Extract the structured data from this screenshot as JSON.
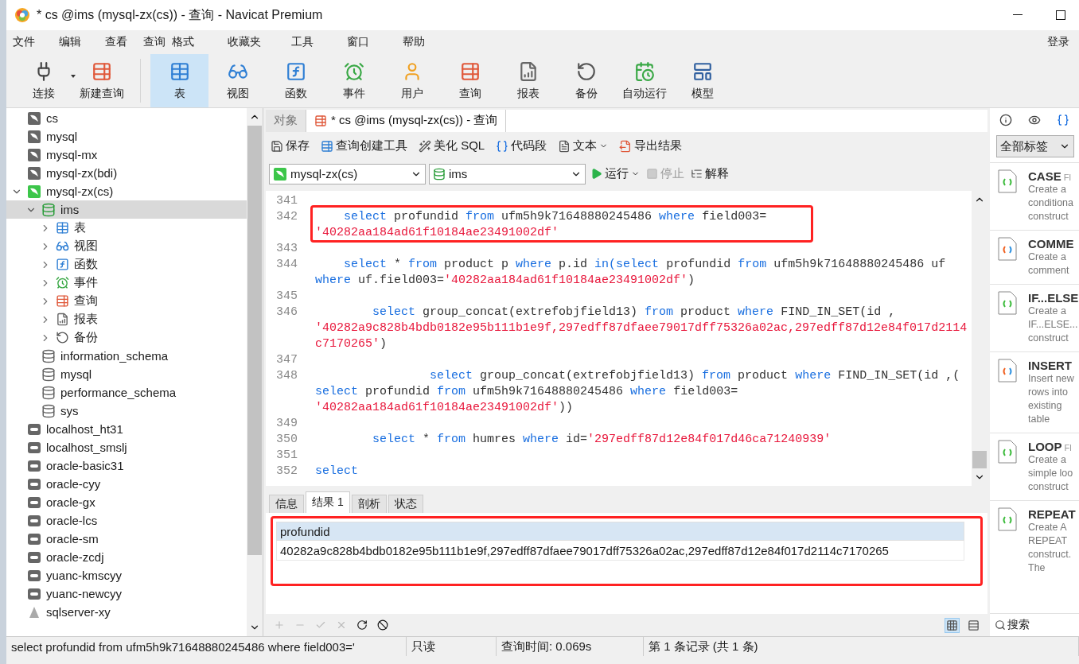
{
  "window": {
    "title": "* cs @ims (mysql-zx(cs)) - 查询 - Navicat Premium"
  },
  "menu": {
    "items": [
      "文件",
      "编辑",
      "查看",
      "查询",
      "格式",
      "收藏夹",
      "工具",
      "窗口",
      "帮助"
    ],
    "login": "登录"
  },
  "toolbar": [
    {
      "kind": "connect",
      "label": "连接",
      "selected": false,
      "dropdown": true
    },
    {
      "kind": "new_query",
      "label": "新建查询",
      "selected": false,
      "dropdown": false
    },
    {
      "kind": "table",
      "label": "表",
      "selected": true,
      "dropdown": false
    },
    {
      "kind": "view",
      "label": "视图",
      "selected": false,
      "dropdown": false
    },
    {
      "kind": "function",
      "label": "函数",
      "selected": false,
      "dropdown": false
    },
    {
      "kind": "event",
      "label": "事件",
      "selected": false,
      "dropdown": false
    },
    {
      "kind": "user",
      "label": "用户",
      "selected": false,
      "dropdown": false
    },
    {
      "kind": "query",
      "label": "查询",
      "selected": false,
      "dropdown": false
    },
    {
      "kind": "report",
      "label": "报表",
      "selected": false,
      "dropdown": false
    },
    {
      "kind": "backup",
      "label": "备份",
      "selected": false,
      "dropdown": false
    },
    {
      "kind": "schedule",
      "label": "自动运行",
      "selected": false,
      "dropdown": false
    },
    {
      "kind": "model",
      "label": "模型",
      "selected": false,
      "dropdown": false
    }
  ],
  "sidebar": {
    "items": [
      {
        "kind": "mysql",
        "label": "cs",
        "selected": false
      },
      {
        "kind": "mysql",
        "label": "mysql",
        "selected": false
      },
      {
        "kind": "mysql",
        "label": "mysql-mx",
        "selected": false
      },
      {
        "kind": "mysql",
        "label": "mysql-zx(bdi)",
        "selected": false
      },
      {
        "kind": "mysql_open",
        "label": "mysql-zx(cs)",
        "selected": false,
        "expanded": true,
        "children": [
          {
            "kind": "database_open",
            "label": "ims",
            "selected": true,
            "expanded": true,
            "children": [
              {
                "kind": "table",
                "label": "表",
                "selected": false,
                "expanded": false
              },
              {
                "kind": "view",
                "label": "视图",
                "selected": false,
                "expanded": false
              },
              {
                "kind": "function",
                "label": "函数",
                "selected": false,
                "expanded": false
              },
              {
                "kind": "event",
                "label": "事件",
                "selected": false,
                "expanded": false
              },
              {
                "kind": "query",
                "label": "查询",
                "selected": false,
                "expanded": false
              },
              {
                "kind": "report",
                "label": "报表",
                "selected": false,
                "expanded": false
              },
              {
                "kind": "backup",
                "label": "备份",
                "selected": false,
                "expanded": false
              }
            ]
          },
          {
            "kind": "database",
            "label": "information_schema",
            "selected": false
          },
          {
            "kind": "database",
            "label": "mysql",
            "selected": false
          },
          {
            "kind": "database",
            "label": "performance_schema",
            "selected": false
          },
          {
            "kind": "database",
            "label": "sys",
            "selected": false
          }
        ]
      },
      {
        "kind": "generic",
        "label": "localhost_ht31",
        "selected": false
      },
      {
        "kind": "generic",
        "label": "localhost_smslj",
        "selected": false
      },
      {
        "kind": "generic",
        "label": "oracle-basic31",
        "selected": false
      },
      {
        "kind": "generic",
        "label": "oracle-cyy",
        "selected": false
      },
      {
        "kind": "generic",
        "label": "oracle-gx",
        "selected": false
      },
      {
        "kind": "generic",
        "label": "oracle-lcs",
        "selected": false
      },
      {
        "kind": "generic",
        "label": "oracle-sm",
        "selected": false
      },
      {
        "kind": "generic",
        "label": "oracle-zcdj",
        "selected": false
      },
      {
        "kind": "generic",
        "label": "yuanc-kmscyy",
        "selected": false
      },
      {
        "kind": "generic",
        "label": "yuanc-newcyy",
        "selected": false
      },
      {
        "kind": "sqlserver",
        "label": "sqlserver-xy",
        "selected": false
      }
    ]
  },
  "editor_tabs": [
    {
      "label": "对象",
      "selected": false,
      "icon": false
    },
    {
      "label": "* cs @ims (mysql-zx(cs)) - 查询",
      "selected": true,
      "icon": true
    }
  ],
  "editor_toolbar": [
    {
      "kind": "save",
      "label": "保存",
      "dropdown": false
    },
    {
      "kind": "builder",
      "label": "查询创建工具",
      "dropdown": false
    },
    {
      "kind": "beautify",
      "label": "美化 SQL",
      "dropdown": false
    },
    {
      "kind": "snippet",
      "label": "代码段",
      "dropdown": false
    },
    {
      "kind": "text",
      "label": "文本",
      "dropdown": true
    },
    {
      "kind": "export",
      "label": "导出结果",
      "dropdown": false
    }
  ],
  "connection_select": "mysql-zx(cs)",
  "database_select": "ims",
  "run_controls": [
    {
      "kind": "run",
      "label": "运行",
      "disabled": false,
      "dropdown": true
    },
    {
      "kind": "stop",
      "label": "停止",
      "disabled": true,
      "dropdown": false
    },
    {
      "kind": "explain",
      "label": "解释",
      "disabled": false,
      "dropdown": false
    }
  ],
  "code": [
    {
      "number": "341",
      "highlighted": false
    },
    {
      "number": "342",
      "highlighted": true,
      "rows": [
        {
          "segments": [
            {
              "kind": "keyword",
              "text": "    select"
            },
            {
              "kind": "plain",
              "text": " profundid "
            },
            {
              "kind": "keyword",
              "text": "from"
            },
            {
              "kind": "plain",
              "text": " ufm5h9k71648880245486 "
            },
            {
              "kind": "keyword",
              "text": "where"
            },
            {
              "kind": "plain",
              "text": " field003="
            }
          ]
        },
        {
          "segments": [
            {
              "kind": "string",
              "text": "'40282aa184ad61f10184ae23491002df'"
            }
          ]
        }
      ]
    },
    {
      "number": "343",
      "highlighted": false
    },
    {
      "number": "344",
      "highlighted": false,
      "rows": [
        {
          "segments": [
            {
              "kind": "keyword",
              "text": "    select"
            },
            {
              "kind": "plain",
              "text": " * "
            },
            {
              "kind": "keyword",
              "text": "from"
            },
            {
              "kind": "plain",
              "text": " product p "
            },
            {
              "kind": "keyword",
              "text": "where"
            },
            {
              "kind": "plain",
              "text": " p.id "
            },
            {
              "kind": "keyword",
              "text": "in(select"
            },
            {
              "kind": "plain",
              "text": " profundid "
            },
            {
              "kind": "keyword",
              "text": "from"
            },
            {
              "kind": "plain",
              "text": " ufm5h9k71648880245486 uf"
            }
          ]
        },
        {
          "segments": [
            {
              "kind": "keyword",
              "text": "where"
            },
            {
              "kind": "plain",
              "text": " uf.field003="
            },
            {
              "kind": "string",
              "text": "'40282aa184ad61f10184ae23491002df'"
            },
            {
              "kind": "plain",
              "text": ")"
            }
          ]
        }
      ]
    },
    {
      "number": "345",
      "highlighted": false
    },
    {
      "number": "346",
      "highlighted": false,
      "rows": [
        {
          "segments": [
            {
              "kind": "keyword",
              "text": "        select"
            },
            {
              "kind": "plain",
              "text": " group_concat(extrefobjfield13) "
            },
            {
              "kind": "keyword",
              "text": "from"
            },
            {
              "kind": "plain",
              "text": " product "
            },
            {
              "kind": "keyword",
              "text": "where"
            },
            {
              "kind": "plain",
              "text": " FIND_IN_SET(id ,"
            }
          ]
        },
        {
          "segments": [
            {
              "kind": "string",
              "text": "'40282a9c828b4bdb0182e95b111b1e9f,297edff87dfaee79017dff75326a02ac,297edff87d12e84f017d2114"
            }
          ]
        },
        {
          "segments": [
            {
              "kind": "string",
              "text": "c7170265'"
            },
            {
              "kind": "plain",
              "text": ")"
            }
          ]
        }
      ]
    },
    {
      "number": "347",
      "highlighted": false
    },
    {
      "number": "348",
      "highlighted": false,
      "rows": [
        {
          "segments": [
            {
              "kind": "keyword",
              "text": "                select"
            },
            {
              "kind": "plain",
              "text": " group_concat(extrefobjfield13) "
            },
            {
              "kind": "keyword",
              "text": "from"
            },
            {
              "kind": "plain",
              "text": " product "
            },
            {
              "kind": "keyword",
              "text": "where"
            },
            {
              "kind": "plain",
              "text": " FIND_IN_SET(id ,("
            }
          ]
        },
        {
          "segments": [
            {
              "kind": "keyword",
              "text": "select"
            },
            {
              "kind": "plain",
              "text": " profundid "
            },
            {
              "kind": "keyword",
              "text": "from"
            },
            {
              "kind": "plain",
              "text": " ufm5h9k71648880245486 "
            },
            {
              "kind": "keyword",
              "text": "where"
            },
            {
              "kind": "plain",
              "text": " field003="
            }
          ]
        },
        {
          "segments": [
            {
              "kind": "string",
              "text": "'40282aa184ad61f10184ae23491002df'"
            },
            {
              "kind": "plain",
              "text": "))"
            }
          ]
        }
      ]
    },
    {
      "number": "349",
      "highlighted": false
    },
    {
      "number": "350",
      "highlighted": false,
      "rows": [
        {
          "segments": [
            {
              "kind": "keyword",
              "text": "        select"
            },
            {
              "kind": "plain",
              "text": " * "
            },
            {
              "kind": "keyword",
              "text": "from"
            },
            {
              "kind": "plain",
              "text": " humres "
            },
            {
              "kind": "keyword",
              "text": "where"
            },
            {
              "kind": "plain",
              "text": " id="
            },
            {
              "kind": "string",
              "text": "'297edff87d12e84f017d46ca71240939'"
            }
          ]
        }
      ]
    },
    {
      "number": "351",
      "highlighted": false
    },
    {
      "number": "352",
      "highlighted": false,
      "rows": [
        {
          "segments": [
            {
              "kind": "keyword",
              "text": "select"
            }
          ]
        }
      ]
    }
  ],
  "result_tabs": [
    {
      "label": "信息",
      "selected": false
    },
    {
      "label": "结果 1",
      "selected": true
    },
    {
      "label": "剖析",
      "selected": false
    },
    {
      "label": "状态",
      "selected": false
    }
  ],
  "result_grid": {
    "highlighted": true,
    "columns": [
      "profundid"
    ],
    "rows": [
      [
        "40282a9c828b4bdb0182e95b111b1e9f,297edff87dfaee79017dff75326a02ac,297edff87d12e84f017d2114c7170265"
      ]
    ]
  },
  "grid_actions": [
    {
      "kind": "add",
      "disabled": true
    },
    {
      "kind": "remove",
      "disabled": true
    },
    {
      "kind": "apply",
      "disabled": true
    },
    {
      "kind": "discard",
      "disabled": true
    },
    {
      "kind": "refresh",
      "disabled": false
    },
    {
      "kind": "stop",
      "disabled": false
    }
  ],
  "view_modes": [
    {
      "kind": "grid",
      "selected": true
    },
    {
      "kind": "form",
      "selected": false
    }
  ],
  "snippet_panel": {
    "tabs": [
      {
        "kind": "info",
        "selected": false
      },
      {
        "kind": "preview",
        "selected": false
      },
      {
        "kind": "snippets",
        "selected": true
      }
    ],
    "filter": "全部标签",
    "items": [
      {
        "title": "CASE",
        "tag": "Fl",
        "multicolor": false,
        "description": [
          "Create a",
          "conditiona",
          "construct"
        ]
      },
      {
        "title": "COMME",
        "multicolor": true,
        "description": [
          "Create a",
          "comment"
        ]
      },
      {
        "title": "IF...ELSE",
        "multicolor": false,
        "description": [
          "Create a",
          "IF...ELSE...",
          "construct"
        ]
      },
      {
        "title": "INSERT",
        "multicolor": true,
        "description": [
          "Insert new",
          "rows into",
          "existing",
          "table"
        ]
      },
      {
        "title": "LOOP",
        "tag": "Fl",
        "multicolor": false,
        "description": [
          "Create a",
          "simple loo",
          "construct"
        ]
      },
      {
        "title": "REPEAT",
        "multicolor": false,
        "description": [
          "Create A",
          "REPEAT",
          "construct.",
          "The"
        ]
      }
    ],
    "search": "搜索"
  },
  "status_bar": [
    {
      "kind": "sql",
      "text": "select profundid from ufm5h9k71648880245486 where field003='"
    },
    {
      "kind": "mode",
      "text": "只读"
    },
    {
      "kind": "time",
      "text": "查询时间: 0.069s"
    },
    {
      "kind": "records",
      "text": "第 1 条记录 (共 1 条)"
    }
  ]
}
